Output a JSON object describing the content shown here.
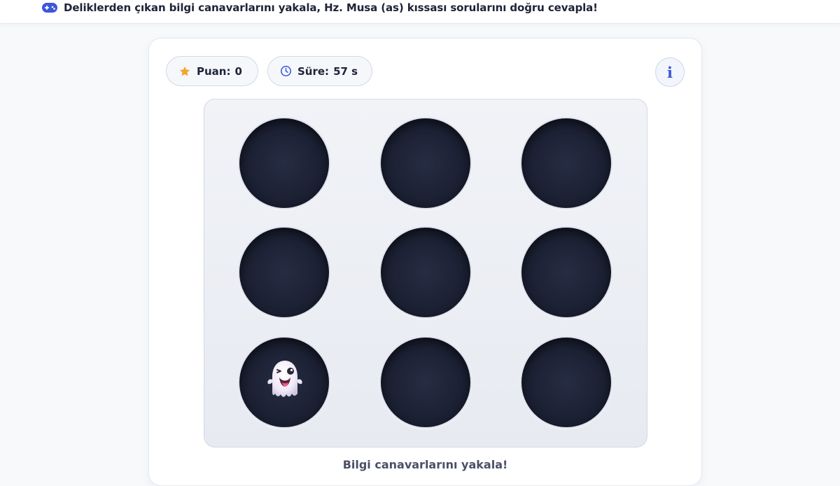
{
  "header": {
    "icon": "gamepad-icon",
    "title": "Deliklerden çıkan bilgi canavarlarını yakala, Hz. Musa (as) kıssası sorularını doğru cevapla!"
  },
  "stats": {
    "score_label": "Puan:",
    "score_value": "0",
    "time_label": "Süre:",
    "time_value": "57 s",
    "score_icon": "star-icon",
    "time_icon": "clock-icon"
  },
  "info_button": {
    "label": "i",
    "icon": "info-icon"
  },
  "board": {
    "rows": 3,
    "cols": 3,
    "holes": [
      {
        "index": 1,
        "content": ""
      },
      {
        "index": 2,
        "content": ""
      },
      {
        "index": 3,
        "content": ""
      },
      {
        "index": 4,
        "content": ""
      },
      {
        "index": 5,
        "content": ""
      },
      {
        "index": 6,
        "content": ""
      },
      {
        "index": 7,
        "content": "ghost-icon"
      },
      {
        "index": 8,
        "content": ""
      },
      {
        "index": 9,
        "content": ""
      }
    ]
  },
  "hint": "Bilgi canavarlarını yakala!",
  "colors": {
    "accent": "#3d57d9",
    "star": "#f0a72e",
    "hole": "#1c2134",
    "board_bg": "#eceff4"
  }
}
